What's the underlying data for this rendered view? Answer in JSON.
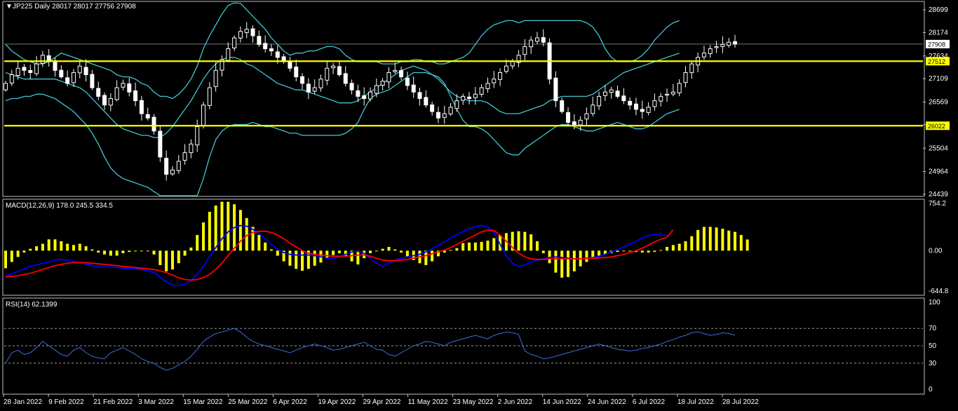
{
  "chart_data": [
    {
      "type": "candlestick",
      "title": "JP225 Daily  28017 28017 27756 27908",
      "symbol": "JP225",
      "timeframe": "Daily",
      "ohlc_last": {
        "open": 28017,
        "high": 28017,
        "low": 27756,
        "close": 27908
      },
      "y_tick_labels": [
        "28699",
        "28174",
        "27634",
        "27109",
        "26569",
        "26044",
        "25504",
        "24964",
        "24439"
      ],
      "ylim": [
        24439,
        28699
      ],
      "current_price": 27908,
      "horizontal_levels": [
        27512,
        26022
      ],
      "level_color": "#ffff00",
      "candle_color": "#ffffff",
      "indicator": "Bollinger Bands",
      "indicator_color": "#3fc5d4",
      "x_tick_labels": [
        "28 Jan 2022",
        "9 Feb 2022",
        "21 Feb 2022",
        "3 Mar 2022",
        "15 Mar 2022",
        "25 Mar 2022",
        "6 Apr 2022",
        "19 Apr 2022",
        "29 Apr 2022",
        "11 May 2022",
        "23 May 2022",
        "2 Jun 2022",
        "14 Jun 2022",
        "24 Jun 2022",
        "6 Jul 2022",
        "18 Jul 2022",
        "28 Jul 2022"
      ],
      "closes": [
        27000,
        27200,
        27350,
        27300,
        27250,
        27450,
        27650,
        27500,
        27300,
        27150,
        27000,
        27250,
        27400,
        27200,
        26900,
        26700,
        26500,
        26650,
        26900,
        27000,
        26800,
        26600,
        26300,
        26200,
        25900,
        25300,
        24900,
        25000,
        25200,
        25400,
        25600,
        26000,
        26500,
        26900,
        27300,
        27550,
        27800,
        28050,
        28200,
        28250,
        28100,
        27900,
        27800,
        27750,
        27600,
        27500,
        27350,
        27150,
        27000,
        26800,
        26900,
        27100,
        27350,
        27400,
        27200,
        27000,
        26850,
        26700,
        26650,
        26800,
        26950,
        27050,
        27250,
        27300,
        27150,
        26950,
        26800,
        26650,
        26500,
        26350,
        26200,
        26300,
        26450,
        26600,
        26700,
        26650,
        26750,
        26900,
        27000,
        27100,
        27250,
        27400,
        27500,
        27650,
        27850,
        28000,
        28050,
        27950,
        27100,
        26600,
        26350,
        26100,
        26050,
        26150,
        26300,
        26500,
        26700,
        26800,
        26850,
        26700,
        26600,
        26500,
        26400,
        26350,
        26450,
        26600,
        26700,
        26750,
        26800,
        27000,
        27250,
        27450,
        27600,
        27700,
        27800,
        27850,
        27900,
        27950,
        27908
      ],
      "bollinger_upper": [
        27900,
        27750,
        27650,
        27550,
        27500,
        27450,
        27450,
        27500,
        27600,
        27700,
        27650,
        27600,
        27550,
        27500,
        27450,
        27400,
        27350,
        27300,
        27200,
        27150,
        27150,
        27100,
        27000,
        26950,
        26800,
        26700,
        26700,
        26650,
        26750,
        26900,
        27100,
        27400,
        27800,
        28100,
        28350,
        28600,
        28800,
        28900,
        28850,
        28700,
        28550,
        28400,
        28250,
        28050,
        27900,
        27750,
        27650,
        27700,
        27700,
        27750,
        27750,
        27800,
        27850,
        27850,
        27800,
        27650,
        27550,
        27500,
        27500,
        27500,
        27500,
        27450,
        27450,
        27450,
        27500,
        27500,
        27550,
        27550,
        27500,
        27500,
        27450,
        27450,
        27500,
        27550,
        27600,
        27700,
        27900,
        28100,
        28250,
        28350,
        28400,
        28450,
        28450,
        28400,
        28450,
        28450,
        28450,
        28450,
        28450,
        28450,
        28450,
        28450,
        28450,
        28450,
        28400,
        28300,
        28100,
        27800,
        27600,
        27500,
        27500,
        27500,
        27550,
        27650,
        27800,
        28000,
        28150,
        28300,
        28400,
        28450
      ],
      "bollinger_lower": [
        26600,
        26650,
        26650,
        26700,
        26700,
        26750,
        26750,
        26700,
        26650,
        26550,
        26450,
        26350,
        26200,
        26050,
        25850,
        25600,
        25300,
        25050,
        24900,
        24800,
        24750,
        24700,
        24650,
        24600,
        24500,
        24300,
        24000,
        23900,
        23900,
        23900,
        24000,
        24300,
        24800,
        25300,
        25700,
        25900,
        26000,
        26050,
        26050,
        26050,
        26100,
        26050,
        26000,
        26000,
        25950,
        25900,
        25850,
        25850,
        25800,
        25800,
        25800,
        25800,
        25800,
        25800,
        25800,
        25850,
        25950,
        26100,
        26400,
        26650,
        26750,
        26800,
        26850,
        26950,
        27050,
        27150,
        27250,
        27250,
        27250,
        27200,
        27150,
        27000,
        26700,
        26400,
        26150,
        26000,
        26000,
        25950,
        25850,
        25700,
        25550,
        25400,
        25350,
        25350,
        25500,
        25600,
        25700,
        25800,
        25900,
        26000,
        26050,
        26050,
        26000,
        25950,
        25900,
        25900,
        25950,
        26000,
        26050,
        26100,
        26050,
        26000,
        25950,
        25950,
        26000,
        26100,
        26200,
        26300,
        26350,
        26400
      ],
      "bollinger_middle": [
        27250,
        27200,
        27150,
        27100,
        27100,
        27100,
        27100,
        27100,
        27100,
        27050,
        27000,
        26950,
        26900,
        26800,
        26650,
        26500,
        26350,
        26200,
        26050,
        25950,
        25900,
        25850,
        25800,
        25800,
        25750,
        25750,
        25850,
        26000,
        26200,
        26400,
        26600,
        26850,
        27100,
        27300,
        27450,
        27550,
        27600,
        27600,
        27550,
        27450,
        27400,
        27300,
        27200,
        27100,
        27000,
        26950,
        26900,
        26850,
        26850,
        26800,
        26750,
        26700,
        26650,
        26600,
        26550,
        26550,
        26550,
        26600,
        26700,
        26800,
        26900,
        27000,
        27100,
        27200,
        27300,
        27350,
        27400,
        27350,
        27300,
        27200,
        27100,
        26950,
        26800,
        26700,
        26650,
        26600,
        26600,
        26600,
        26550,
        26450,
        26350,
        26300,
        26300,
        26300,
        26350,
        26400,
        26450,
        26500,
        26600,
        26650,
        26700,
        26700,
        26700,
        26700,
        26700,
        26750,
        26850,
        26950,
        27050,
        27150,
        27250,
        27300,
        27350,
        27400,
        27450,
        27500,
        27550,
        27600,
        27650,
        27700
      ]
    },
    {
      "type": "line+bar",
      "title": "MACD(12,26,9) 178.0 245.5 334.5",
      "y_tick_labels": [
        "754.2",
        "0.00",
        "-644.8"
      ],
      "ylim": [
        -644.8,
        754.2
      ],
      "histogram_color": "#ffff00",
      "macd_color": "#0000ff",
      "signal_color": "#ff0000",
      "histogram": [
        -280,
        -180,
        -100,
        -30,
        30,
        70,
        110,
        180,
        180,
        150,
        110,
        90,
        110,
        70,
        20,
        -30,
        -60,
        -80,
        -80,
        -40,
        -20,
        -10,
        -10,
        -10,
        -60,
        -230,
        -330,
        -300,
        -200,
        -80,
        50,
        250,
        450,
        620,
        720,
        780,
        780,
        740,
        650,
        520,
        380,
        250,
        130,
        20,
        -80,
        -170,
        -240,
        -290,
        -320,
        -290,
        -240,
        -190,
        -130,
        -70,
        -40,
        -90,
        -170,
        -220,
        -120,
        -40,
        -10,
        30,
        60,
        20,
        -30,
        -90,
        -150,
        -200,
        -230,
        -170,
        -90,
        -30,
        10,
        40,
        120,
        130,
        130,
        140,
        160,
        200,
        250,
        280,
        300,
        310,
        300,
        260,
        150,
        -40,
        -200,
        -350,
        -430,
        -420,
        -330,
        -250,
        -180,
        -120,
        -80,
        -60,
        -40,
        -20,
        0,
        -10,
        -20,
        -30,
        -30,
        -20,
        10,
        60,
        90,
        110,
        150,
        230,
        330,
        380,
        380,
        370,
        350,
        320,
        300,
        250,
        178
      ],
      "macd": [
        -400,
        -370,
        -330,
        -290,
        -250,
        -230,
        -200,
        -180,
        -150,
        -140,
        -150,
        -170,
        -190,
        -210,
        -240,
        -260,
        -260,
        -260,
        -270,
        -280,
        -280,
        -290,
        -300,
        -320,
        -350,
        -420,
        -500,
        -550,
        -560,
        -540,
        -480,
        -380,
        -250,
        -100,
        50,
        190,
        300,
        370,
        400,
        390,
        340,
        270,
        190,
        100,
        20,
        -30,
        -60,
        -70,
        -70,
        -70,
        -80,
        -100,
        -120,
        -120,
        -100,
        -60,
        -20,
        -10,
        -40,
        -120,
        -200,
        -250,
        -200,
        -150,
        -120,
        -100,
        -80,
        -60,
        -20,
        30,
        80,
        140,
        200,
        260,
        300,
        350,
        380,
        400,
        380,
        290,
        100,
        -80,
        -200,
        -250,
        -230,
        -180,
        -150,
        -130,
        -110,
        -100,
        -110,
        -120,
        -130,
        -130,
        -120,
        -110,
        -90,
        -60,
        -20,
        20,
        60,
        100,
        150,
        200,
        240,
        260,
        250,
        245.5
      ],
      "signal": [
        -420,
        -410,
        -400,
        -380,
        -360,
        -330,
        -300,
        -270,
        -240,
        -220,
        -200,
        -190,
        -190,
        -190,
        -200,
        -210,
        -220,
        -230,
        -240,
        -250,
        -260,
        -270,
        -280,
        -290,
        -300,
        -320,
        -350,
        -390,
        -430,
        -460,
        -470,
        -460,
        -430,
        -380,
        -300,
        -200,
        -80,
        40,
        150,
        240,
        290,
        310,
        310,
        290,
        250,
        190,
        120,
        60,
        0,
        -40,
        -60,
        -70,
        -80,
        -90,
        -90,
        -90,
        -80,
        -70,
        -70,
        -90,
        -120,
        -150,
        -160,
        -160,
        -150,
        -140,
        -120,
        -100,
        -80,
        -50,
        -20,
        10,
        50,
        100,
        150,
        200,
        250,
        300,
        330,
        320,
        250,
        150,
        50,
        -40,
        -100,
        -130,
        -140,
        -140,
        -130,
        -130,
        -130,
        -130,
        -130,
        -130,
        -125,
        -120,
        -115,
        -110,
        -100,
        -80,
        -60,
        -30,
        0,
        40,
        90,
        140,
        180,
        215,
        334.5
      ]
    },
    {
      "type": "line",
      "title": "RSI(14) 62.1399",
      "y_tick_labels": [
        "100",
        "70",
        "50",
        "30",
        "0"
      ],
      "ylim": [
        0,
        100
      ],
      "reference_levels": [
        70,
        50,
        30
      ],
      "line_color": "#3a6fd8",
      "values": [
        30,
        42,
        45,
        40,
        42,
        48,
        55,
        50,
        45,
        40,
        38,
        45,
        48,
        42,
        38,
        36,
        35,
        42,
        45,
        48,
        44,
        40,
        35,
        32,
        30,
        25,
        22,
        24,
        28,
        32,
        38,
        46,
        55,
        60,
        64,
        66,
        68,
        70,
        66,
        60,
        55,
        52,
        50,
        48,
        46,
        44,
        42,
        45,
        48,
        50,
        52,
        50,
        48,
        45,
        46,
        48,
        50,
        52,
        54,
        50,
        46,
        45,
        40,
        38,
        42,
        46,
        50,
        52,
        55,
        54,
        52,
        50,
        54,
        56,
        58,
        60,
        62,
        60,
        58,
        62,
        64,
        66,
        65,
        63,
        44,
        40,
        38,
        35,
        36,
        38,
        40,
        42,
        44,
        46,
        48,
        50,
        52,
        50,
        48,
        46,
        45,
        44,
        45,
        47,
        48,
        50,
        52,
        55,
        57,
        60,
        62,
        65,
        66,
        64,
        62,
        63,
        65,
        64,
        62.1399
      ]
    }
  ]
}
